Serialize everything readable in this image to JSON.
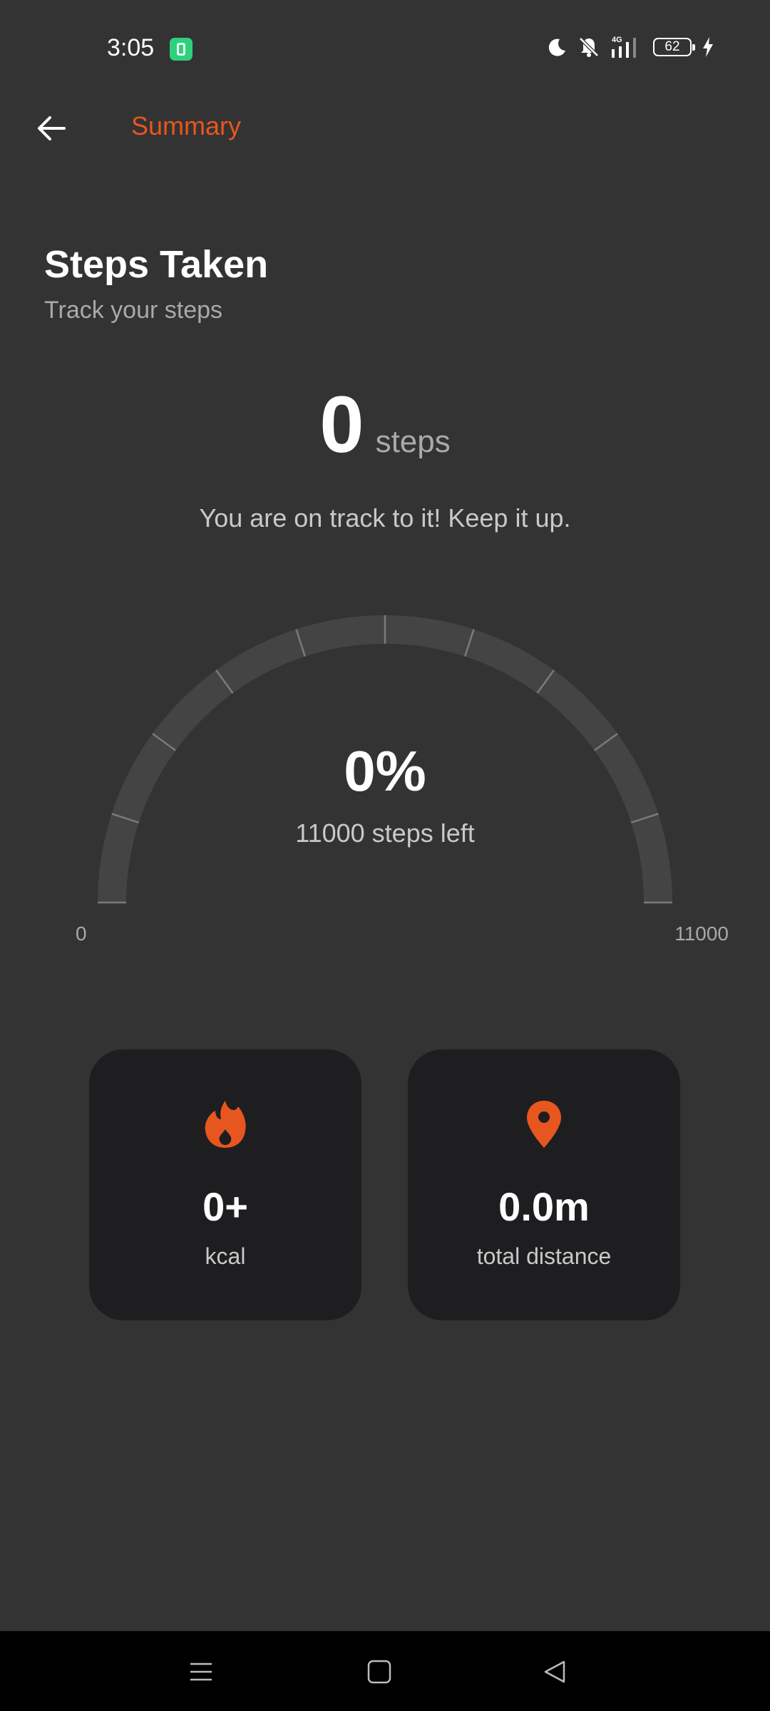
{
  "status_bar": {
    "time": "3:05",
    "battery_level": "62",
    "icons": [
      "app-notification-icon",
      "moon-icon",
      "bell-off-icon",
      "signal-4g-icon",
      "battery-icon",
      "charging-icon"
    ]
  },
  "app_bar": {
    "back_icon": "arrow-left-icon",
    "title": "Summary"
  },
  "header": {
    "title": "Steps Taken",
    "subtitle": "Track your steps"
  },
  "steps": {
    "count": "0",
    "unit": "steps",
    "message": "You are on track to it! Keep it up."
  },
  "gauge": {
    "percent_label": "0%",
    "remaining_label": "11000 steps left",
    "min_label": "0",
    "max_label": "11000",
    "progress": 0,
    "goal": 11000
  },
  "stats": {
    "kcal": {
      "icon": "fire-icon",
      "value": "0+",
      "label": "kcal"
    },
    "distance": {
      "icon": "location-pin-icon",
      "value": "0.0m",
      "label": "total distance"
    }
  },
  "nav_bar": {
    "icons": [
      "menu-icon",
      "home-icon",
      "back-triangle-icon"
    ]
  },
  "colors": {
    "accent": "#e8561f",
    "background": "#333333",
    "card": "#1e1e20",
    "gauge_track": "#444444"
  }
}
